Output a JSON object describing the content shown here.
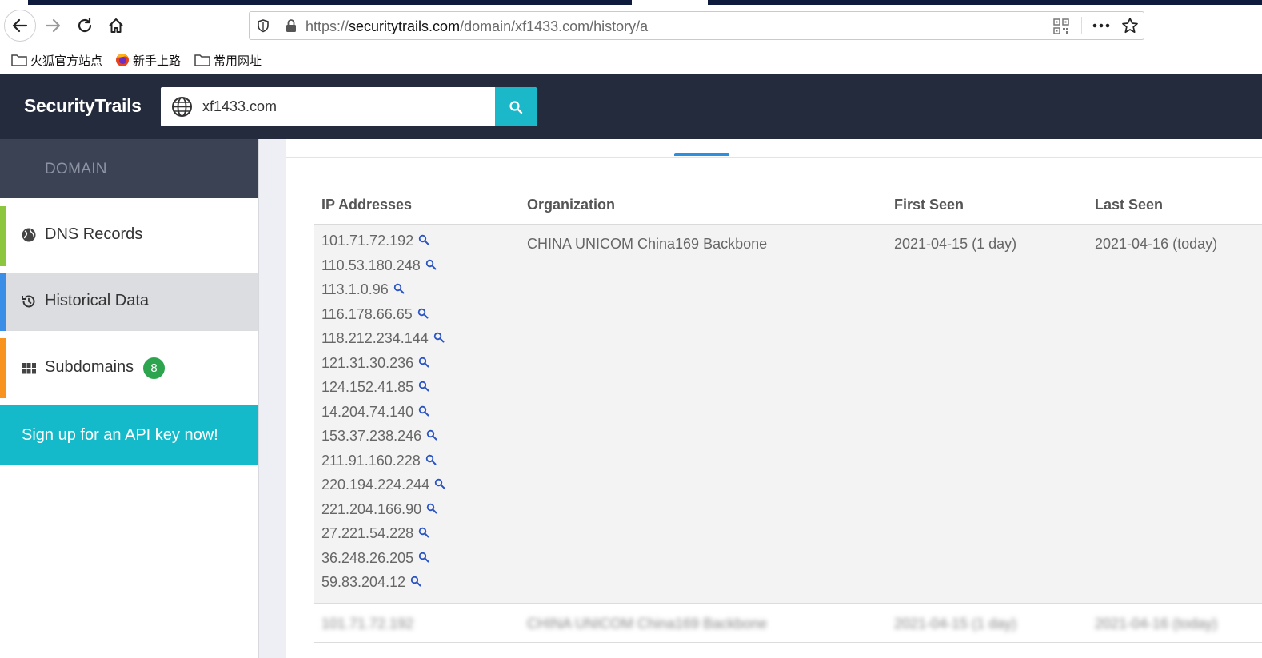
{
  "browser": {
    "url_scheme": "https://",
    "url_host": "securitytrails.com",
    "url_path": "/domain/xf1433.com/history/a",
    "bookmarks": [
      {
        "label": "火狐官方站点",
        "icon": "folder-icon"
      },
      {
        "label": "新手上路",
        "icon": "firefox-icon"
      },
      {
        "label": "常用网址",
        "icon": "folder-icon"
      }
    ]
  },
  "header": {
    "logo": "SecurityTrails",
    "search_value": "xf1433.com"
  },
  "sidebar": {
    "heading": "DOMAIN",
    "items": [
      {
        "label": "DNS Records",
        "icon": "globe-icon",
        "color": "#8cc63f"
      },
      {
        "label": "Historical Data",
        "icon": "history-icon",
        "color": "#3a8ee6"
      },
      {
        "label": "Subdomains",
        "icon": "grid-icon",
        "color": "#f7931e",
        "badge": "8"
      }
    ],
    "signup_label": "Sign up for an API key now!"
  },
  "table": {
    "headers": {
      "ip": "IP Addresses",
      "org": "Organization",
      "first": "First Seen",
      "last": "Last Seen"
    },
    "row": {
      "ips": [
        "101.71.72.192",
        "110.53.180.248",
        "113.1.0.96",
        "116.178.66.65",
        "118.212.234.144",
        "121.31.30.236",
        "124.152.41.85",
        "14.204.74.140",
        "153.37.238.246",
        "211.91.160.228",
        "220.194.224.244",
        "221.204.166.90",
        "27.221.54.228",
        "36.248.26.205",
        "59.83.204.12"
      ],
      "org": "CHINA UNICOM China169 Backbone",
      "first": "2021-04-15 (1 day)",
      "last": "2021-04-16 (today)"
    },
    "blurred_row": {
      "ip": "101.71.72.192",
      "org": "CHINA UNICOM China169 Backbone",
      "first": "2021-04-15 (1 day)",
      "last": "2021-04-16 (today)"
    }
  },
  "colors": {
    "header_bg": "#232b3c",
    "accent": "#1ab8c9",
    "badge": "#2da44e",
    "link_icon": "#2a54c4"
  }
}
